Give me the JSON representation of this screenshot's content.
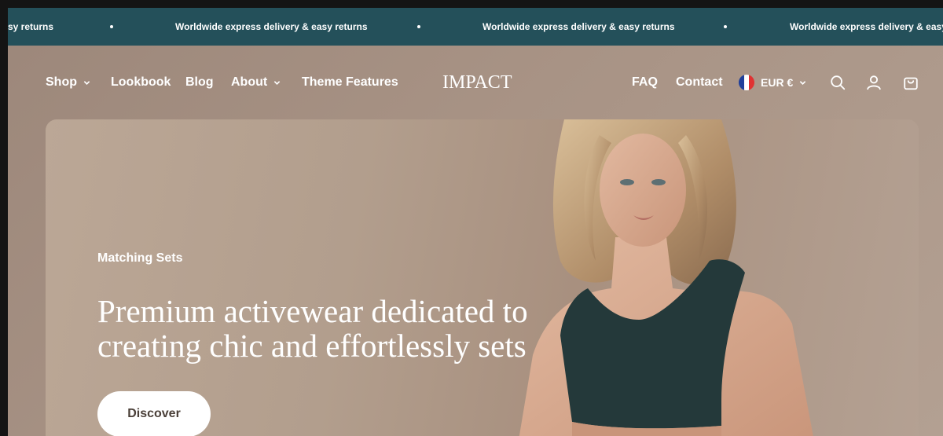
{
  "announcement": {
    "messages": [
      "sy returns",
      "Worldwide express delivery & easy returns",
      "Worldwide express delivery & easy returns",
      "Worldwide express delivery & easy re"
    ]
  },
  "nav": {
    "left": [
      {
        "label": "Shop",
        "has_dropdown": true
      },
      {
        "label": "Lookbook",
        "has_dropdown": false
      },
      {
        "label": "Blog",
        "has_dropdown": false
      },
      {
        "label": "About",
        "has_dropdown": true
      },
      {
        "label": "Theme Features",
        "has_dropdown": false
      }
    ],
    "logo": "IMPACT",
    "right": {
      "faq": "FAQ",
      "contact": "Contact",
      "currency": "EUR €"
    },
    "icons": [
      "search-icon",
      "account-icon",
      "cart-icon"
    ]
  },
  "hero": {
    "eyebrow": "Matching Sets",
    "title": "Premium activewear dedicated to creating chic and effortlessly sets",
    "button_label": "Discover"
  },
  "colors": {
    "announcement_bg": "#24505a",
    "hero_bg": "#b29e8d",
    "text": "#ffffff",
    "button_bg": "#ffffff",
    "button_text": "#4a3f38",
    "top_garment": "#24393a"
  }
}
